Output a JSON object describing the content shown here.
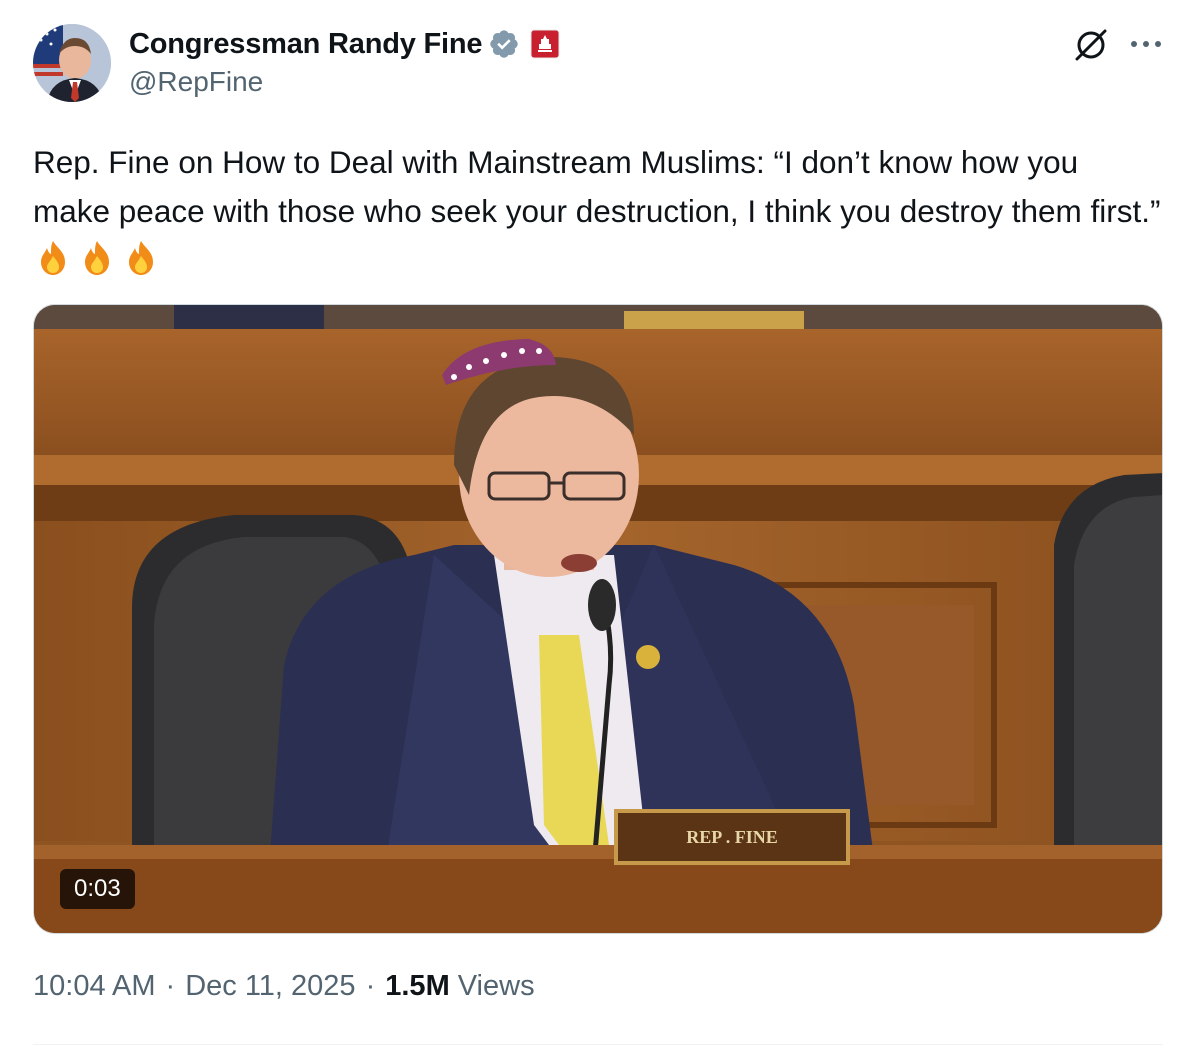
{
  "author": {
    "display_name": "Congressman Randy Fine",
    "handle": "@RepFine",
    "verified_badge_icon": "verified-badge-icon",
    "affiliation_icon": "us-house-seal-icon",
    "verified_color": "#829aab"
  },
  "actions": {
    "grok_icon": "grok-icon",
    "more_icon": "more-options-icon"
  },
  "tweet": {
    "text": "Rep. Fine on How to Deal with Mainstream Muslims: “I don’t know how you make peace with those who seek your destruction, I think you destroy them first.”",
    "emoji": [
      "🔥",
      "🔥",
      "🔥"
    ]
  },
  "media": {
    "type": "video",
    "duration": "0:03",
    "nameplate": "REP . FINE"
  },
  "meta": {
    "time": "10:04 AM",
    "date": "Dec 11, 2025",
    "views_count": "1.5M",
    "views_label": "Views"
  },
  "colors": {
    "text_primary": "#0f1419",
    "text_secondary": "#536471",
    "border": "#cfd9de"
  }
}
